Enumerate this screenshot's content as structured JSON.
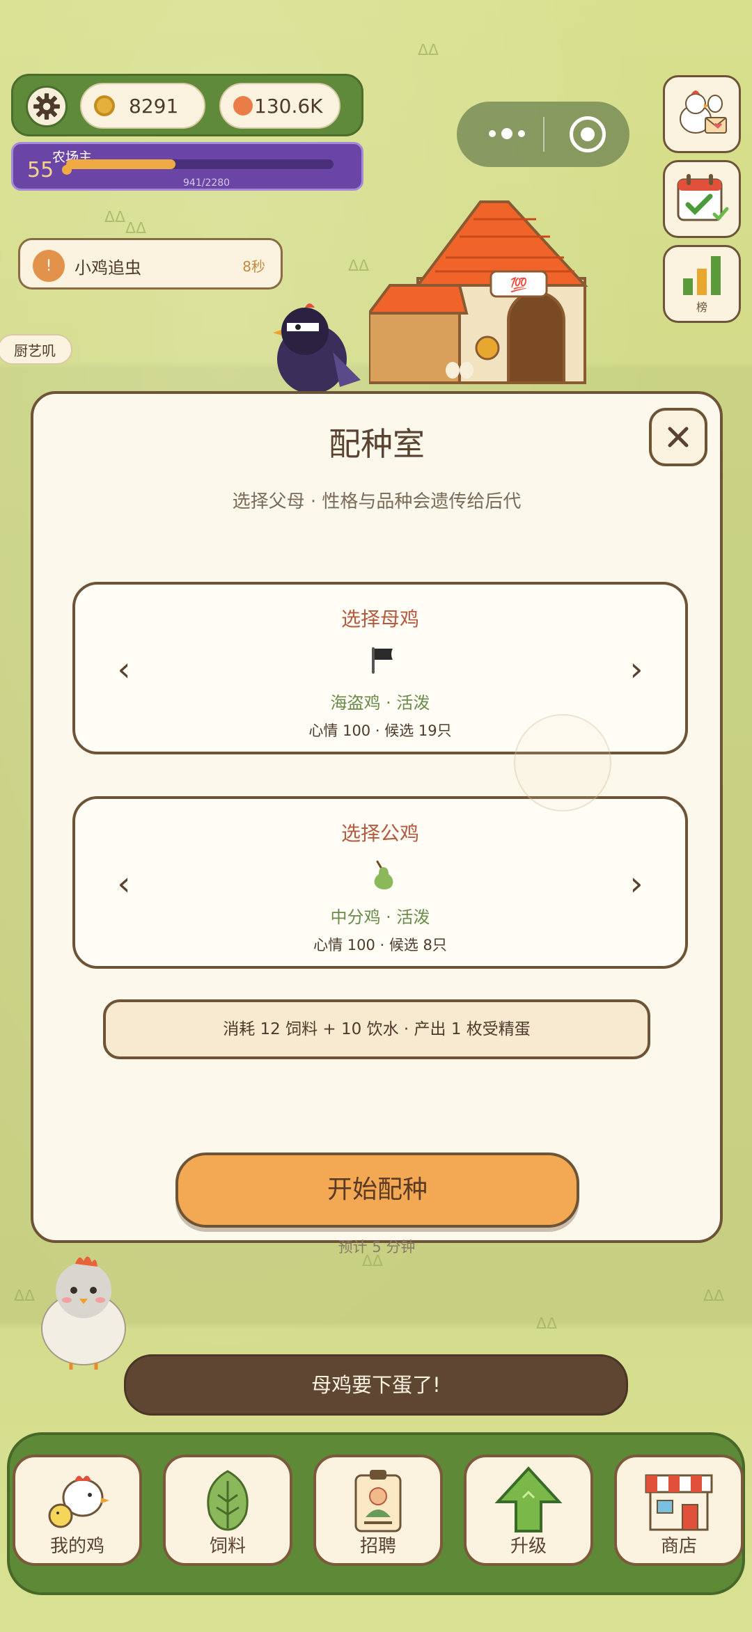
{
  "hud": {
    "coins": "8291",
    "gems": "130.6K",
    "level": "55",
    "rank_title": "农场主",
    "xp_text": "941/2280",
    "xp_progress": 0.41
  },
  "side_buttons": {
    "leaderboard_label": "榜"
  },
  "task": {
    "icon": "!",
    "name": "小鸡追虫",
    "time": "8秒"
  },
  "chef_tag": "厨艺叽",
  "modal": {
    "title": "配种室",
    "subtitle": "选择父母 · 性格与品种会遗传给后代",
    "hen": {
      "title": "选择母鸡",
      "icon": "black-flag-icon",
      "breed": "海盗鸡 · 活泼",
      "stats": "心情 100 · 候选 19只"
    },
    "rooster": {
      "title": "选择公鸡",
      "icon": "pear-icon",
      "breed": "中分鸡 · 活泼",
      "stats": "心情 100 · 候选 8只"
    },
    "prev_arrow": "‹",
    "next_arrow": "›",
    "cost": "消耗 12 饲料 + 10 饮水 · 产出 1 枚受精蛋",
    "start_button": "开始配种",
    "eta": "预计 5 分钟"
  },
  "toast": "母鸡要下蛋了!",
  "nav": [
    {
      "label": "我的鸡",
      "icon": "chicken-icon"
    },
    {
      "label": "饲料",
      "icon": "leaf-icon"
    },
    {
      "label": "招聘",
      "icon": "id-badge-icon"
    },
    {
      "label": "升级",
      "icon": "up-arrow-icon"
    },
    {
      "label": "商店",
      "icon": "shop-icon"
    }
  ],
  "colors": {
    "accent_orange": "#f3a953",
    "frame_brown": "#6e5436",
    "grass_green": "#5e8a38",
    "xp_purple": "#6a45a6"
  }
}
